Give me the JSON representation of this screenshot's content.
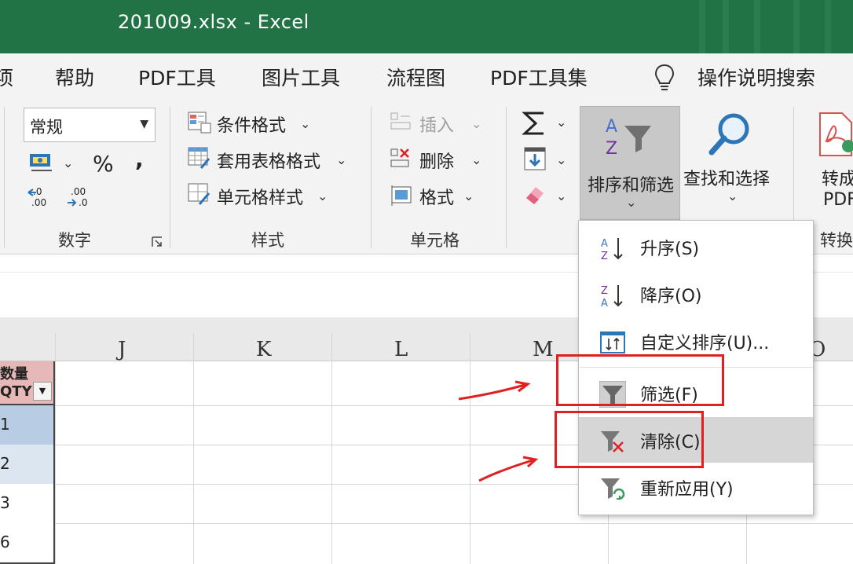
{
  "window": {
    "title": "201009.xlsx  -  Excel"
  },
  "menu": {
    "items": [
      "项",
      "帮助",
      "PDF工具",
      "图片工具",
      "流程图",
      "PDF工具集"
    ],
    "search_tip": "操作说明搜索"
  },
  "ribbon": {
    "number_group": {
      "format_value": "常规",
      "percent": "%",
      "comma": ",",
      "label": "数字"
    },
    "styles_group": {
      "conditional_format": "条件格式",
      "table_format": "套用表格格式",
      "cell_style": "单元格样式",
      "label": "样式"
    },
    "cells_group": {
      "insert": "插入",
      "delete": "删除",
      "format": "格式",
      "label": "单元格"
    },
    "editing_group": {
      "sort_filter": "排序和筛选",
      "find_select": "查找和选择"
    },
    "convert_group": {
      "line1": "转成",
      "line2": "PDF",
      "label": "转换"
    }
  },
  "grid": {
    "columns": [
      "J",
      "K",
      "L",
      "M",
      "O"
    ],
    "header_cell": {
      "line1": "数量",
      "line2": "QTY"
    },
    "row_values": [
      "1",
      "2",
      "3",
      "6"
    ],
    "row_fill_colors": [
      "#b8cce4",
      "#dce6f1",
      "#ffffff",
      "#ffffff"
    ]
  },
  "sort_menu": {
    "items": [
      {
        "label": "升序(S)",
        "icon": "sort-ascending-icon"
      },
      {
        "label": "降序(O)",
        "icon": "sort-descending-icon"
      },
      {
        "label": "自定义排序(U)...",
        "icon": "custom-sort-icon"
      },
      {
        "label": "筛选(F)",
        "icon": "filter-icon"
      },
      {
        "label": "清除(C)",
        "icon": "clear-filter-icon"
      },
      {
        "label": "重新应用(Y)",
        "icon": "reapply-filter-icon"
      }
    ],
    "hovered_item": "清除(C)"
  },
  "colors": {
    "excel_green": "#217346",
    "annotation_red": "#e02020",
    "header_pink": "#e6b8b7"
  }
}
